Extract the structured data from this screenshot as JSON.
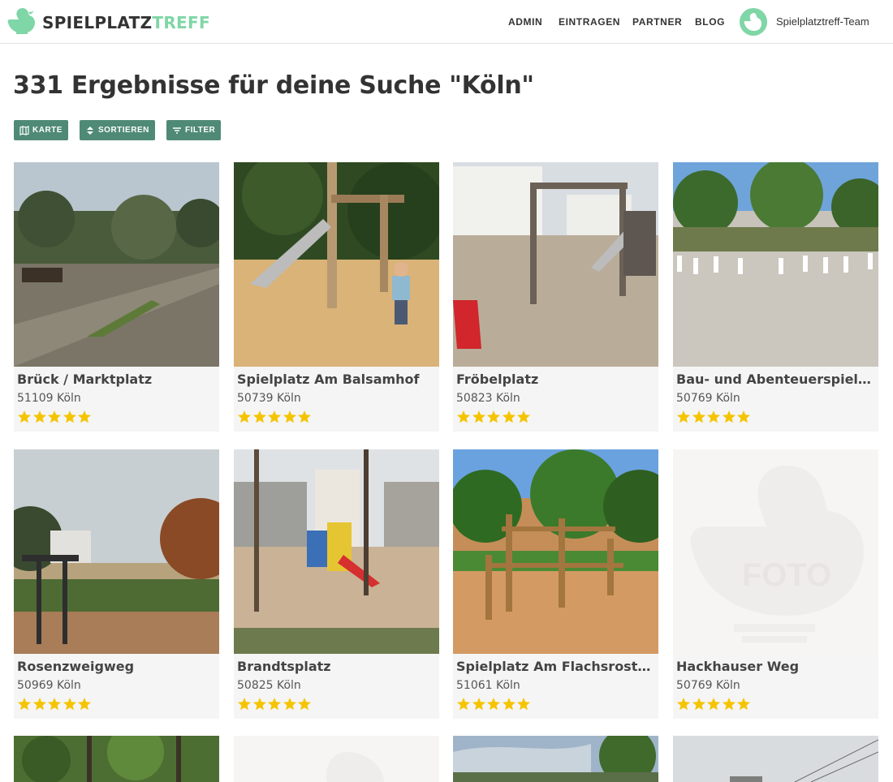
{
  "header": {
    "logo_part1": "SPIELPLATZ",
    "logo_part2": "TREFF",
    "nav": [
      "ADMIN",
      "EINTRAGEN",
      "PARTNER",
      "BLOG"
    ],
    "user_name": "Spielplatztreff-Team"
  },
  "page_title": "331 Ergebnisse für deine Suche \"Köln\"",
  "toolbar": {
    "map_label": "KARTE",
    "sort_label": "SORTIEREN",
    "filter_label": "FILTER"
  },
  "colors": {
    "brand_green": "#7fd6a6",
    "button_green": "#4f8a76",
    "star_yellow": "#f5c400"
  },
  "results": [
    {
      "name": "Brück / Marktplatz",
      "location": "51109 Köln",
      "rating": 5
    },
    {
      "name": "Spielplatz Am Balsamhof",
      "location": "50739 Köln",
      "rating": 5
    },
    {
      "name": "Fröbelplatz",
      "location": "50823 Köln",
      "rating": 5
    },
    {
      "name": "Bau- und Abenteuerspielplatz Höhenberg",
      "location": "50769 Köln",
      "rating": 5
    },
    {
      "name": "Rosenzweigweg",
      "location": "50969 Köln",
      "rating": 5
    },
    {
      "name": "Brandtsplatz",
      "location": "50825 Köln",
      "rating": 5
    },
    {
      "name": "Spielplatz Am Flachsrosterweg",
      "location": "51061 Köln",
      "rating": 5
    },
    {
      "name": "Hackhauser Weg",
      "location": "50769 Köln",
      "rating": 5
    }
  ],
  "placeholder_photo_label": "FOTO"
}
